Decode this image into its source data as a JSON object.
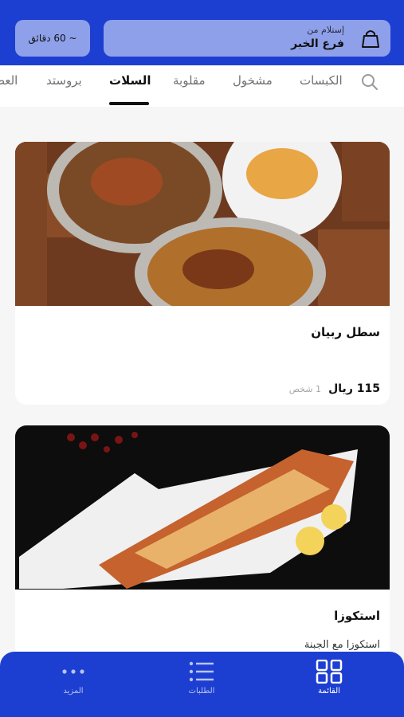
{
  "header": {
    "pickup_from": "إستلام من",
    "branch": "فرع الخبر",
    "time_estimate": "~ 60 دقائق"
  },
  "tabs": [
    "الكبسات",
    "مشخول",
    "مقلوبة",
    "السلات",
    "بروستد",
    "العص"
  ],
  "active_tab": "السلات",
  "menu_items": [
    {
      "name": "سطل ربيان",
      "price": "115 ريال",
      "serves": "1 شخص"
    },
    {
      "name": "استكوزا",
      "description": "استكوزا مع الجبنة"
    }
  ],
  "bottom_nav": {
    "menu": "القائمة",
    "orders": "الطلبات",
    "more": "المزيد"
  },
  "colors": {
    "accent": "#1d3fd1",
    "pill": "#8fa0ea"
  }
}
